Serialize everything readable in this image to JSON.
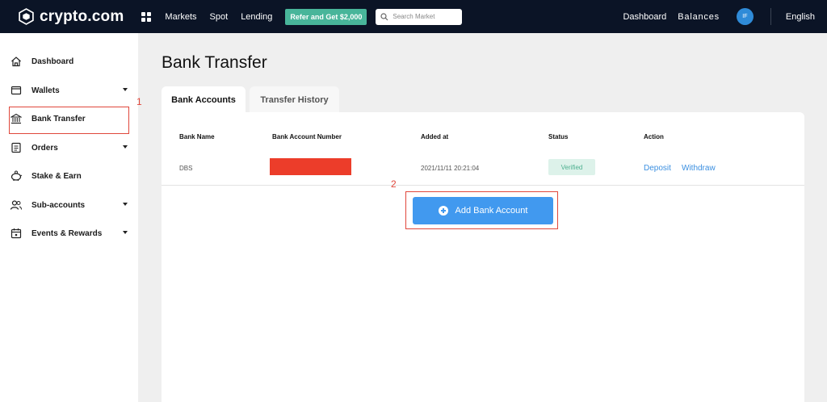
{
  "topbar": {
    "logo_text": "crypto.com",
    "nav": [
      "Markets",
      "Spot",
      "Lending"
    ],
    "refer_label": "Refer and Get $2,000",
    "search_placeholder": "Search Market",
    "dashboard_label": "Dashboard",
    "balances_label": "Balances",
    "avatar_initials": "IF",
    "language": "English"
  },
  "sidebar": {
    "items": [
      {
        "label": "Dashboard",
        "icon": "home-icon"
      },
      {
        "label": "Wallets",
        "icon": "wallet-icon"
      },
      {
        "label": "Bank Transfer",
        "icon": "bank-icon"
      },
      {
        "label": "Orders",
        "icon": "orders-icon"
      },
      {
        "label": "Stake & Earn",
        "icon": "piggy-bank-icon"
      },
      {
        "label": "Sub-accounts",
        "icon": "users-icon"
      },
      {
        "label": "Events & Rewards",
        "icon": "calendar-icon"
      }
    ]
  },
  "annotations": {
    "marker_1": "1",
    "marker_2": "2"
  },
  "main": {
    "title": "Bank Transfer",
    "tabs": [
      {
        "label": "Bank Accounts"
      },
      {
        "label": "Transfer History"
      }
    ],
    "table": {
      "headers": [
        "Bank Name",
        "Bank Account Number",
        "Added at",
        "Status",
        "Action"
      ],
      "rows": [
        {
          "bank_name": "DBS",
          "added_at": "2021/11/11 20:21:04",
          "status": "Verified",
          "deposit": "Deposit",
          "withdraw": "Withdraw"
        }
      ]
    },
    "add_button_label": "Add Bank Account"
  },
  "colors": {
    "topbar_bg": "#0b1426",
    "accent_blue": "#4199ef",
    "refer_green": "#48b59a",
    "highlight_red": "#e0473b",
    "redaction_red": "#ec3d2a"
  }
}
